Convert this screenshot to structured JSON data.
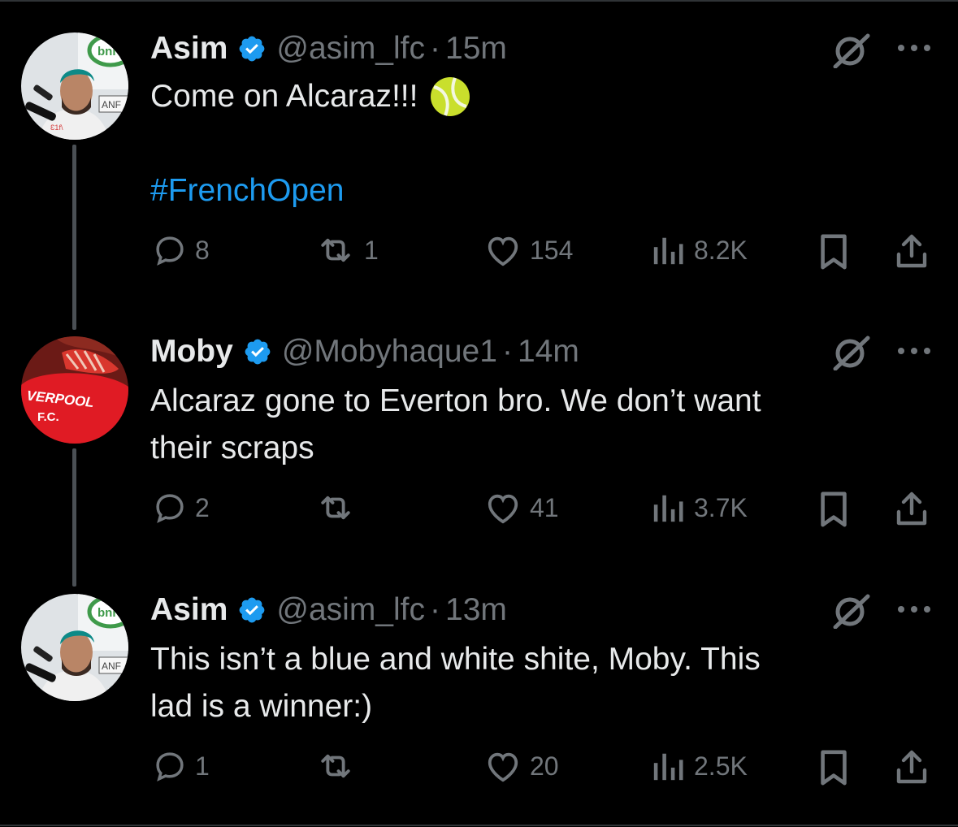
{
  "colors": {
    "background": "#000000",
    "text": "#e7e9ea",
    "muted": "#71767b",
    "link": "#1d9bf0",
    "verified": "#1d9bf0",
    "divider": "#2f3336"
  },
  "tweets": [
    {
      "name": "Asim",
      "handle": "@asim_lfc",
      "separator": "·",
      "time": "15m",
      "text_line1": "Come on Alcaraz!!!",
      "emoji": "tennis-ball",
      "hashtag": "#FrenchOpen",
      "avatar": "person-with-headphones-avatar",
      "replies": "8",
      "retweets": "1",
      "likes": "154",
      "views": "8.2K"
    },
    {
      "name": "Moby",
      "handle": "@Mobyhaque1",
      "separator": "·",
      "time": "14m",
      "text_line1": "Alcaraz gone to Everton bro. We don’t want",
      "text_line2": "their scraps",
      "avatar": "liverpool-fc-cap-avatar",
      "avatar_text": "VERPOOL F.C.",
      "replies": "2",
      "retweets": "",
      "likes": "41",
      "views": "3.7K"
    },
    {
      "name": "Asim",
      "handle": "@asim_lfc",
      "separator": "·",
      "time": "13m",
      "text_line1": "This isn’t a blue and white shite, Moby. This",
      "text_line2": "lad is a winner:)",
      "avatar": "person-with-headphones-avatar",
      "replies": "1",
      "retweets": "",
      "likes": "20",
      "views": "2.5K"
    }
  ]
}
